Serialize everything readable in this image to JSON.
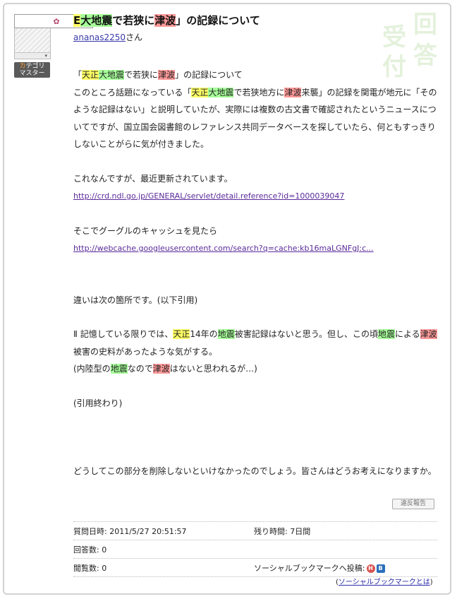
{
  "question": {
    "title_parts": [
      {
        "text": "E",
        "hl": "y"
      },
      {
        "text": "大地震",
        "hl": "g"
      },
      {
        "text": "で若狭に",
        "hl": ""
      },
      {
        "text": "津波",
        "hl": "p"
      },
      {
        "text": "」の記録について",
        "hl": ""
      }
    ],
    "user": "ananas2250",
    "user_suffix": "さん",
    "badge_ka": "カ",
    "badge_rest": "テゴリ",
    "badge_line2": "マスター",
    "stamp_chars": [
      "回",
      "答",
      "受",
      "付"
    ],
    "report_label": "違反報告"
  },
  "body": {
    "p1": [
      {
        "text": "「",
        "hl": ""
      },
      {
        "text": "天正",
        "hl": "y"
      },
      {
        "text": "大地震",
        "hl": "g"
      },
      {
        "text": "で若狭に",
        "hl": ""
      },
      {
        "text": "津波",
        "hl": "p"
      },
      {
        "text": "」の記録について",
        "hl": ""
      }
    ],
    "p2": [
      {
        "text": "このところ話題になっている「",
        "hl": ""
      },
      {
        "text": "天正",
        "hl": "y"
      },
      {
        "text": "大地震",
        "hl": "g"
      },
      {
        "text": "で若狭地方に",
        "hl": ""
      },
      {
        "text": "津波",
        "hl": "p"
      },
      {
        "text": "来襲」の記録を関電が地元に「そのような記録はない」と説明していたが、実際には複数の古文書で確認されたというニュースについてですが、国立国会図書館のレファレンス共同データベースを探していたら、何ともすっきりしないことがらに気が付きました。",
        "hl": ""
      }
    ],
    "p3": "これなんですが、最近更新されています。",
    "link1": "http://crd.ndl.go.jp/GENERAL/servlet/detail.reference?id=1000039047",
    "p4": "そこでグーグルのキャッシュを見たら",
    "link2": "http://webcache.googleusercontent.com/search?q=cache:kb16maLGNFgJ:c...",
    "p5": "違いは次の箇所です。(以下引用)",
    "p6": [
      {
        "text": "Ⅱ 記憶している限りでは、",
        "hl": ""
      },
      {
        "text": "天正",
        "hl": "y"
      },
      {
        "text": "14年の",
        "hl": ""
      },
      {
        "text": "地震",
        "hl": "g"
      },
      {
        "text": "被害記録はないと思う。但し、この頃",
        "hl": ""
      },
      {
        "text": "地震",
        "hl": "g"
      },
      {
        "text": "による",
        "hl": ""
      },
      {
        "text": "津波",
        "hl": "p"
      },
      {
        "text": "被害の史料があったような気がする。",
        "hl": ""
      }
    ],
    "p7": [
      {
        "text": "(内陸型の",
        "hl": ""
      },
      {
        "text": "地震",
        "hl": "g"
      },
      {
        "text": "なので",
        "hl": ""
      },
      {
        "text": "津波",
        "hl": "p"
      },
      {
        "text": "はないと思われるが…)",
        "hl": ""
      }
    ],
    "p8": "(引用終わり)",
    "p9": "どうしてこの部分を削除しないといけなかったのでしょう。皆さんはどうお考えになりますか。"
  },
  "meta": {
    "asked_label": "質問日時:",
    "asked_value": "2011/5/27 20:51:57",
    "remaining_label": "残り時間:",
    "remaining_value": "7日間",
    "answers_label": "回答数:",
    "answers_value": "0",
    "views_label": "閲覧数:",
    "views_value": "0",
    "social_label": "ソーシャルブックマークへ投稿:",
    "social_icon_h": "H",
    "social_icon_b": "B",
    "social_link": "ソーシャルブックマークとは",
    "paren_open": "(",
    "paren_close": ")"
  }
}
